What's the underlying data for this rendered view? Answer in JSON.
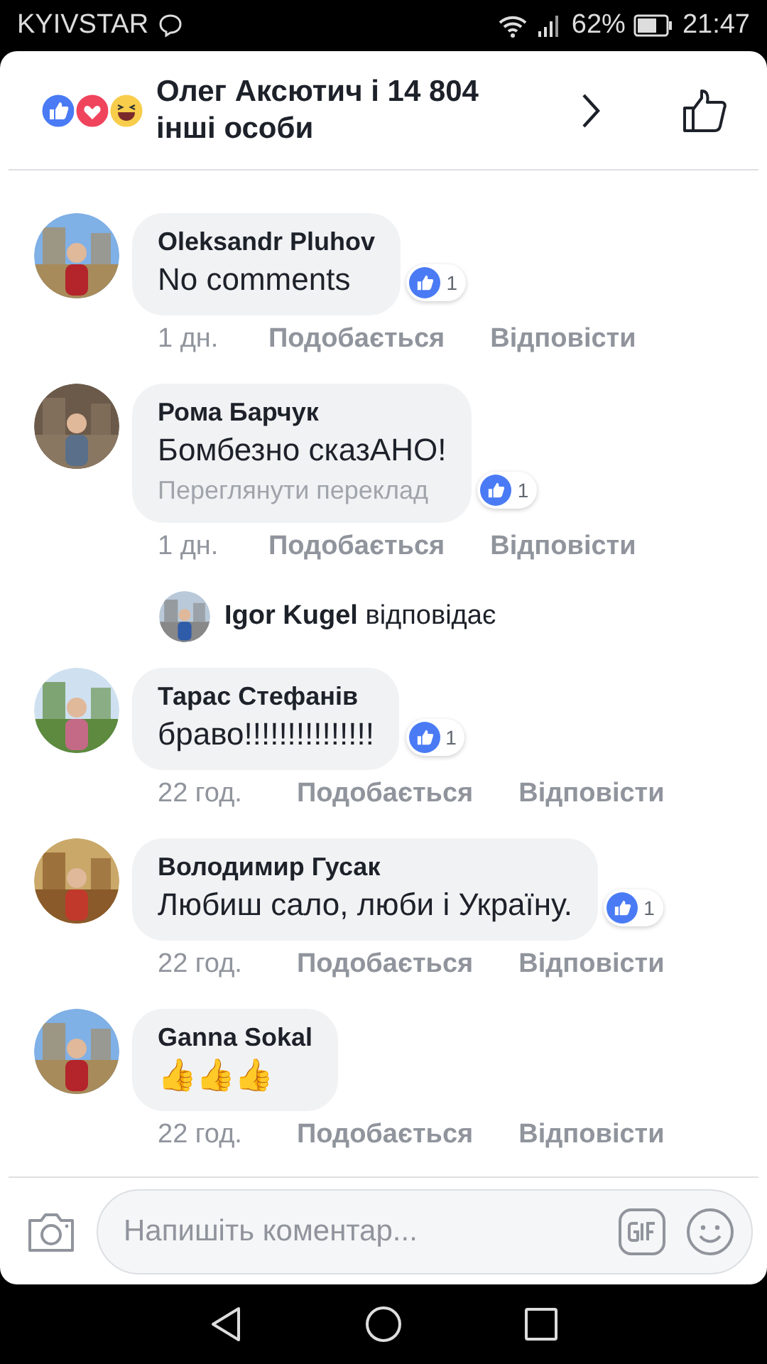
{
  "status_bar": {
    "carrier": "KYIVSTAR",
    "battery": "62%",
    "time": "21:47"
  },
  "header": {
    "reactions": [
      {
        "kind": "like"
      },
      {
        "kind": "love"
      },
      {
        "kind": "haha"
      }
    ],
    "title": "Олег Аксютич і 14 804 інші особи"
  },
  "comments": [
    {
      "kind": "comment",
      "name": "Oleksandr Pluhov",
      "text": "No comments",
      "likes": "1",
      "time": "1 дн.",
      "like_label": "Подобається",
      "reply_label": "Відповісти"
    },
    {
      "kind": "comment",
      "name": "Рома Барчук",
      "text": "Бомбезно сказАНО!",
      "translate": "Переглянути переклад",
      "likes": "1",
      "time": "1 дн.",
      "like_label": "Подобається",
      "reply_label": "Відповісти"
    },
    {
      "kind": "reply_note",
      "text": "**Igor Kugel** відповідає"
    },
    {
      "kind": "comment",
      "name": "Тарас Стефанів",
      "text": "браво!!!!!!!!!!!!!!!",
      "likes": "1",
      "time": "22 год.",
      "like_label": "Подобається",
      "reply_label": "Відповісти"
    },
    {
      "kind": "comment",
      "name": "Володимир Гусак",
      "text": "Любиш сало, люби і Україну.",
      "likes": "1",
      "time": "22 год.",
      "like_label": "Подобається",
      "reply_label": "Відповісти"
    },
    {
      "kind": "comment",
      "name": "Ganna Sokal",
      "text": "👍👍👍",
      "time": "22 год.",
      "like_label": "Подобається",
      "reply_label": "Відповісти"
    }
  ],
  "composer": {
    "placeholder": "Напишіть коментар..."
  }
}
